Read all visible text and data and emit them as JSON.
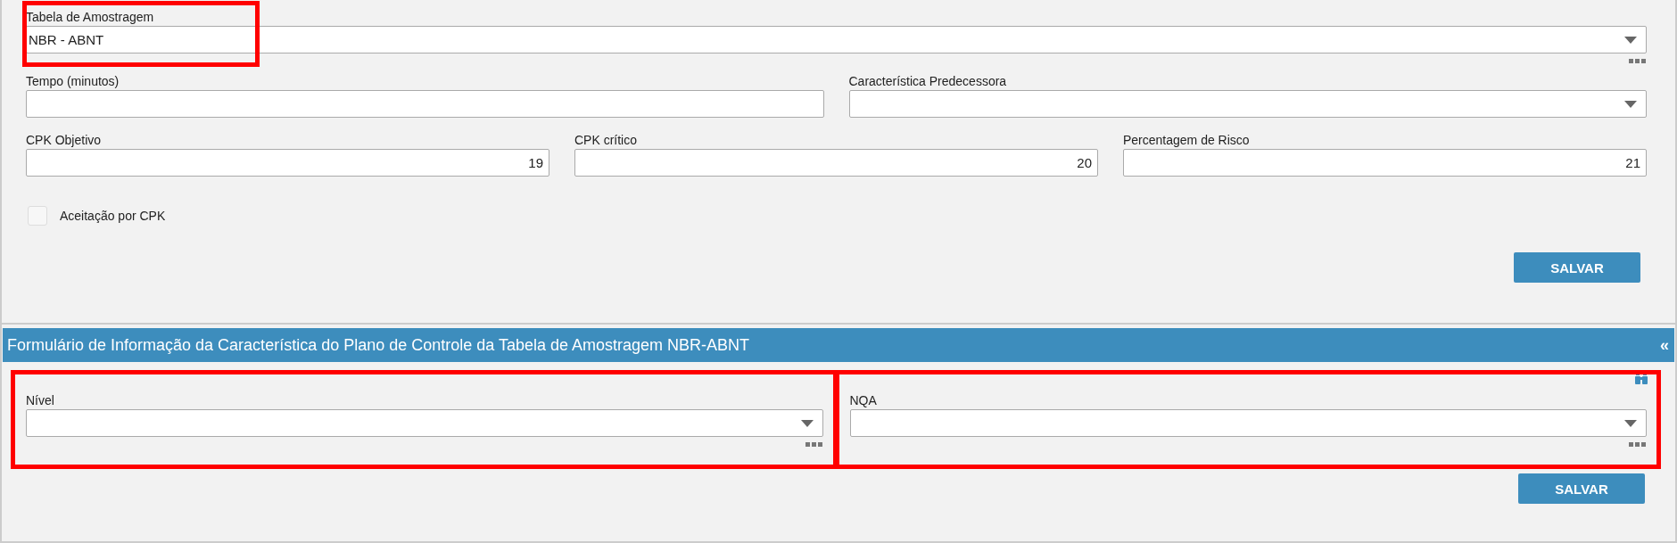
{
  "form": {
    "table_field": {
      "label": "Tabela de Amostragem",
      "value": "NBR - ABNT",
      "highlighted": true
    },
    "time_field": {
      "label": "Tempo (minutos)"
    },
    "predecessor_field": {
      "label": "Característica Predecessora"
    },
    "cpk_fields": [
      {
        "label": "CPK Objetivo",
        "value": "19"
      },
      {
        "label": "CPK crítico",
        "value": "20"
      },
      {
        "label": "Percentagem de Risco",
        "value": "21"
      }
    ],
    "checkbox": {
      "label": "Aceitação por CPK",
      "checked": false
    },
    "save_button": "SALVAR"
  },
  "section": {
    "title": "Formulário de Informação da Característica do Plano de Controle da Tabela de Amostragem NBR-ABNT",
    "collapse_icon": "«",
    "fields": [
      {
        "label": "Nível",
        "highlighted": true
      },
      {
        "label": "NQA",
        "highlighted": true
      }
    ],
    "save_button": "SALVAR"
  }
}
